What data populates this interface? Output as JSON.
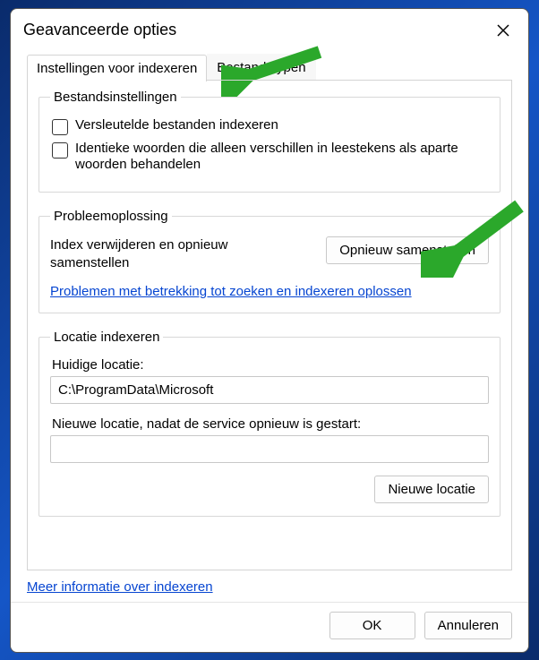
{
  "title": "Geavanceerde opties",
  "tabs": {
    "indexing": "Instellingen voor indexeren",
    "filetypes": "Bestandstypen"
  },
  "group_file": {
    "legend": "Bestandsinstellingen",
    "encrypt": "Versleutelde bestanden indexeren",
    "diacritics": "Identieke woorden die alleen verschillen in leestekens als aparte woorden behandelen"
  },
  "group_troubleshoot": {
    "legend": "Probleemoplossing",
    "rebuild_text": "Index verwijderen en opnieuw samenstellen",
    "rebuild_btn": "Opnieuw samenstellen",
    "trouble_link": "Problemen met betrekking tot zoeken en indexeren oplossen"
  },
  "group_location": {
    "legend": "Locatie indexeren",
    "current_label": "Huidige locatie:",
    "current_value": "C:\\ProgramData\\Microsoft",
    "new_label": "Nieuwe locatie, nadat de service opnieuw is gestart:",
    "new_value": "",
    "new_btn": "Nieuwe locatie"
  },
  "more_info_link": "Meer informatie over indexeren",
  "buttons": {
    "ok": "OK",
    "cancel": "Annuleren"
  }
}
